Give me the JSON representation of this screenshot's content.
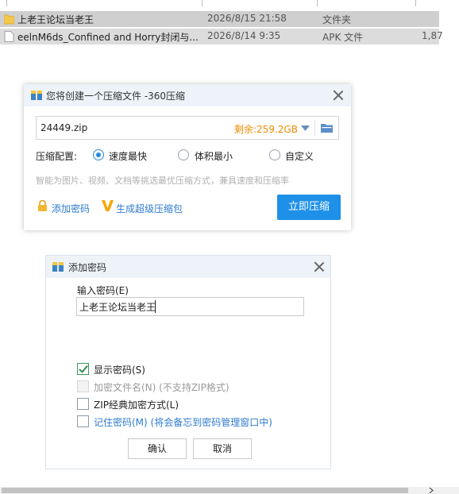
{
  "file_list": {
    "rows": [
      {
        "name": "上老王论坛当老王",
        "date": "2026/8/15 21:58",
        "type": "文件夹",
        "size": ""
      },
      {
        "name": "eelnM6ds_Confined and Horry封闭与...",
        "date": "2026/8/14 9:35",
        "type": "APK 文件",
        "size": "1,87"
      }
    ]
  },
  "compress_dialog": {
    "title": "您将创建一个压缩文件 -360压缩",
    "filename": "24449.zip",
    "remaining_space": "剩余:259.2GB",
    "config_label": "压缩配置:",
    "options": [
      {
        "label": "速度最快",
        "selected": true
      },
      {
        "label": "体积最小",
        "selected": false
      },
      {
        "label": "自定义",
        "selected": false
      }
    ],
    "hint": "智能为图片、视频、文档等挑选最优压缩方式，兼具速度和压缩率",
    "add_password_link": "添加密码",
    "super_package_link": "生成超级压缩包",
    "compress_button": "立即压缩",
    "accent_color": "#1e90e8",
    "icons": [
      "archive-icon",
      "close-icon",
      "dropdown-icon",
      "folder-icon",
      "lock-icon",
      "v-badge-icon"
    ]
  },
  "password_dialog": {
    "title": "添加密码",
    "input_label": "输入密码(E)",
    "password_value": "上老王论坛当老王",
    "checkboxes": [
      {
        "label": "显示密码(S)",
        "checked": true,
        "disabled": false
      },
      {
        "label": "加密文件名(N) (不支持ZIP格式)",
        "checked": false,
        "disabled": true
      },
      {
        "label": "ZIP经典加密方式(L)",
        "checked": false,
        "disabled": false
      },
      {
        "label": "记住密码(M) (将会备忘到密码管理窗口中)",
        "checked": false,
        "disabled": false
      }
    ],
    "ok_button": "确认",
    "cancel_button": "取消"
  }
}
